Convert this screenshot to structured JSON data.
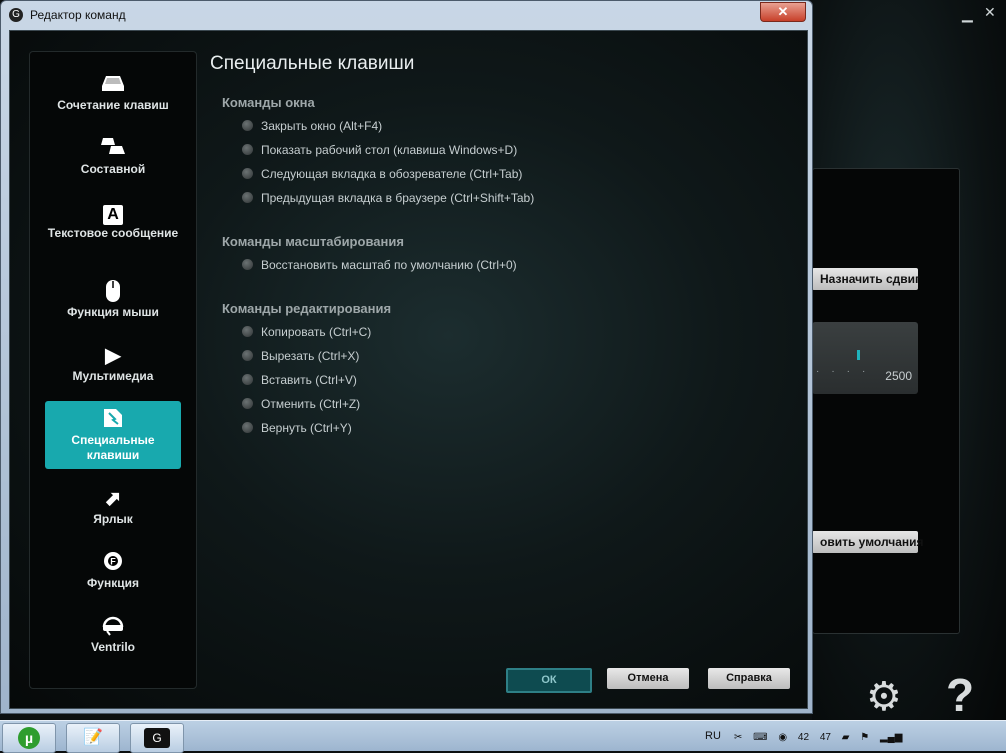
{
  "window": {
    "title": "Редактор команд",
    "close_label": "✕"
  },
  "sidebar": {
    "items": [
      {
        "label": "Сочетание клавиш",
        "icon": "keycap-icon"
      },
      {
        "label": "Составной",
        "icon": "multikey-icon"
      },
      {
        "label": "Текстовое сообщение",
        "icon": "text-block-icon",
        "glyph": "A"
      },
      {
        "label": "Функция мыши",
        "icon": "mouse-icon"
      },
      {
        "label": "Мультимедиа",
        "icon": "play-icon",
        "glyph": "▶"
      },
      {
        "label": "Специальные клавиши",
        "icon": "special-keys-icon",
        "active": true
      },
      {
        "label": "Ярлык",
        "icon": "shortcut-arrow-icon",
        "glyph": "⬈"
      },
      {
        "label": "Функция",
        "icon": "function-gear-icon"
      },
      {
        "label": "Ventrilo",
        "icon": "headset-icon"
      }
    ]
  },
  "main": {
    "title": "Специальные клавиши",
    "groups": [
      {
        "title": "Команды окна",
        "options": [
          "Закрыть окно (Alt+F4)",
          "Показать рабочий стол (клавиша Windows+D)",
          "Следующая вкладка в обозревателе (Ctrl+Tab)",
          "Предыдущая вкладка в браузере (Ctrl+Shift+Tab)"
        ]
      },
      {
        "title": "Команды масштабирования",
        "options": [
          "Восстановить масштаб по умолчанию (Ctrl+0)"
        ]
      },
      {
        "title": "Команды редактирования",
        "options": [
          "Копировать (Ctrl+C)",
          "Вырезать (Ctrl+X)",
          "Вставить (Ctrl+V)",
          "Отменить (Ctrl+Z)",
          "Вернуть (Ctrl+Y)"
        ]
      }
    ]
  },
  "buttons": {
    "ok": "ОК",
    "cancel": "Отмена",
    "help": "Справка"
  },
  "background_app": {
    "assign_shift_button": "Назначить сдвиг",
    "restore_defaults_button": "овить умолчания",
    "dpi_value": "2500",
    "accent_color": "#18a9ae"
  },
  "taskbar": {
    "language": "RU",
    "tray_numbers": [
      "42",
      "47"
    ]
  }
}
